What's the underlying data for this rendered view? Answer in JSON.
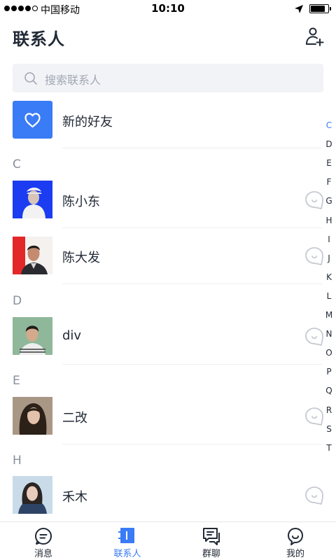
{
  "status_bar": {
    "carrier": "中国移动",
    "time": "10:10",
    "battery_level": 0.85
  },
  "header": {
    "title": "联系人",
    "add_icon": "add-user-icon"
  },
  "search": {
    "placeholder": "搜索联系人",
    "icon": "search-icon"
  },
  "new_friends": {
    "label": "新的好友",
    "icon": "heart-icon",
    "color": "#3a7bf6"
  },
  "sections": [
    {
      "letter": "C",
      "contacts": [
        {
          "name": "陈小东"
        },
        {
          "name": "陈大发"
        }
      ]
    },
    {
      "letter": "D",
      "contacts": [
        {
          "name": "div"
        }
      ]
    },
    {
      "letter": "E",
      "contacts": [
        {
          "name": "二改"
        }
      ]
    },
    {
      "letter": "H",
      "contacts": [
        {
          "name": "禾木"
        }
      ]
    }
  ],
  "index_bar": [
    "C",
    "D",
    "E",
    "F",
    "G",
    "H",
    "I",
    "J",
    "K",
    "L",
    "M",
    "N",
    "O",
    "P",
    "Q",
    "R",
    "S",
    "T"
  ],
  "index_active": "C",
  "tab_bar": [
    {
      "label": "消息",
      "icon": "message-icon"
    },
    {
      "label": "联系人",
      "icon": "contacts-icon"
    },
    {
      "label": "群聊",
      "icon": "group-chat-icon"
    },
    {
      "label": "我的",
      "icon": "profile-icon"
    }
  ],
  "active_tab": "联系人",
  "colors": {
    "accent": "#3a7bf6",
    "text": "#222a36",
    "muted": "#8a8f99",
    "search_bg": "#f1f3f7"
  }
}
